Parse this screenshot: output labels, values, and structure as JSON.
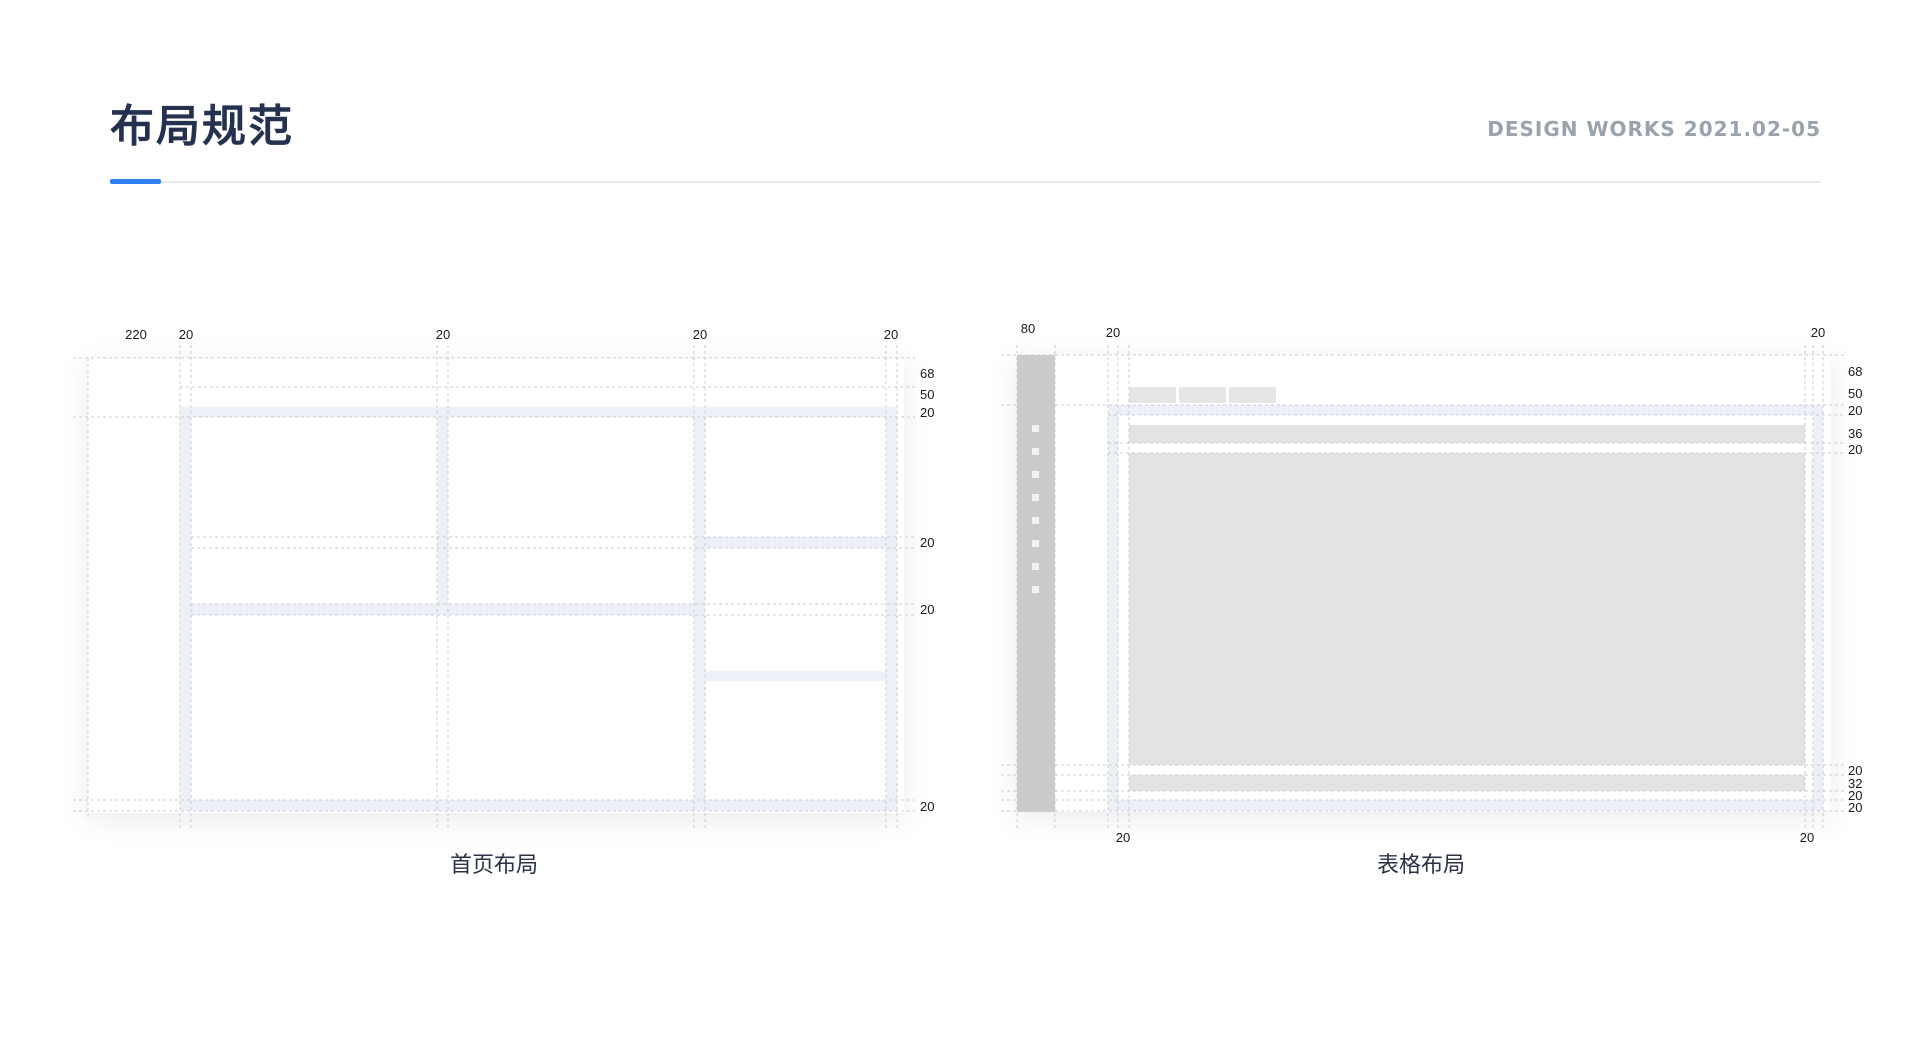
{
  "header": {
    "title": "布局规范",
    "meta": "DESIGN WORKS 2021.02-05"
  },
  "colors": {
    "accent": "#2f7ff5",
    "title": "#24324f",
    "meta": "#9aa2ae",
    "gutter": "#edf0f7",
    "block": "#e3e3e3",
    "sidebar": "#cbcbcb"
  },
  "homepage_layout": {
    "caption": "首页布局",
    "top_labels": [
      "220",
      "20",
      "20",
      "20",
      "20"
    ],
    "right_labels": [
      "68",
      "50",
      "20",
      "20",
      "20",
      "20"
    ]
  },
  "table_layout": {
    "caption": "表格布局",
    "top_labels": [
      "80",
      "20",
      "20"
    ],
    "right_labels": [
      "68",
      "50",
      "20",
      "36",
      "20",
      "20",
      "32",
      "20",
      "20"
    ],
    "bottom_labels": [
      "20",
      "20"
    ]
  }
}
